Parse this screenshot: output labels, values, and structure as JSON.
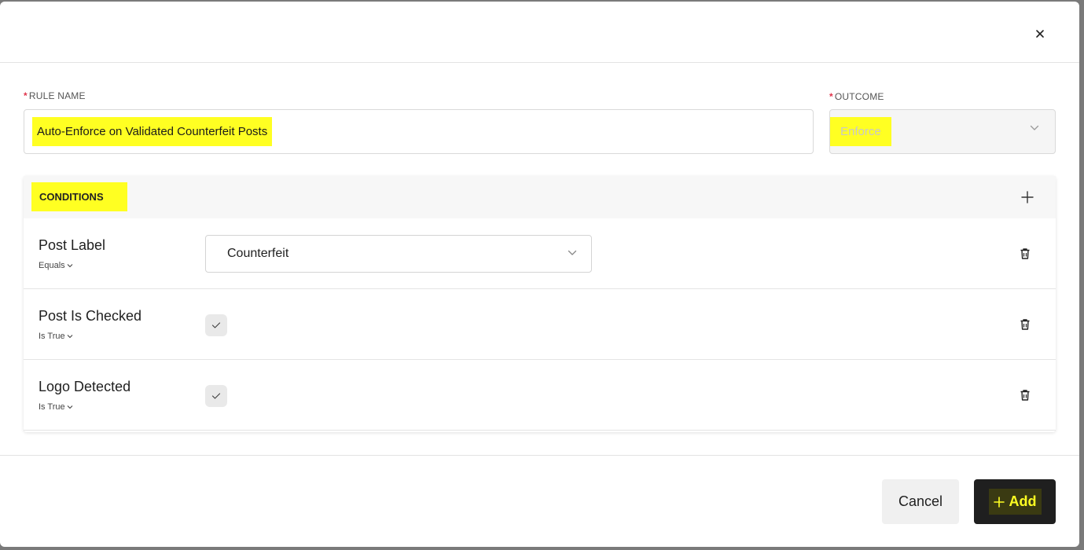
{
  "dialog": {
    "close_label": "×"
  },
  "rule_name": {
    "required_mark": "*",
    "label": "RULE NAME",
    "value": "Auto-Enforce on Validated Counterfeit Posts"
  },
  "outcome": {
    "required_mark": "*",
    "label": "OUTCOME",
    "value": "Enforce"
  },
  "conditions": {
    "title": "CONDITIONS",
    "rows": [
      {
        "name": "Post Label",
        "operator": "Equals",
        "value": "Counterfeit",
        "type": "select"
      },
      {
        "name": "Post Is Checked",
        "operator": "Is True",
        "checked": true,
        "type": "checkbox"
      },
      {
        "name": "Logo Detected",
        "operator": "Is True",
        "checked": true,
        "type": "checkbox"
      }
    ]
  },
  "footer": {
    "cancel_label": "Cancel",
    "add_label": "Add"
  },
  "colors": {
    "highlight": "#ffff22",
    "required": "#e0344b",
    "primary_button": "#1f1f1f"
  },
  "icons": {
    "close": "close-icon",
    "chevron": "chevron-down-icon",
    "add_condition": "plus-icon",
    "delete": "trash-icon",
    "check": "check-icon"
  }
}
